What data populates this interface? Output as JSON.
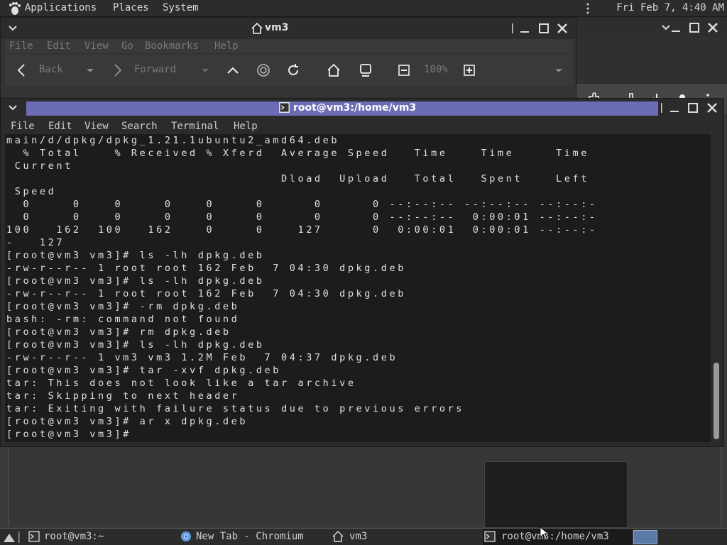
{
  "top_panel": {
    "menus": [
      "Applications",
      "Places",
      "System"
    ],
    "clock": "Fri Feb  7,  4:40 AM"
  },
  "file_manager": {
    "title": "vm3",
    "menus": [
      "File",
      "Edit",
      "View",
      "Go",
      "Bookmarks",
      "Help"
    ],
    "toolbar": {
      "back": "Back",
      "forward": "Forward",
      "zoom": "100%"
    }
  },
  "terminal": {
    "title": "root@vm3:/home/vm3",
    "menus": [
      "File",
      "Edit",
      "View",
      "Search",
      "Terminal",
      "Help"
    ],
    "lines": [
      "main/d/dpkg/dpkg_1.21.1ubuntu2_amd64.deb",
      "  % Total    % Received % Xferd  Average Speed   Time    Time     Time",
      " Current",
      "                                 Dload  Upload   Total   Spent    Left",
      " Speed",
      "  0     0    0     0    0     0      0      0 --:--:-- --:--:-- --:--:-",
      "  0     0    0     0    0     0      0      0 --:--:--  0:00:01 --:--:-",
      "100   162  100   162    0     0    127      0  0:00:01  0:00:01 --:--:-",
      "-   127",
      "[root@vm3 vm3]# ls -lh dpkg.deb",
      "-rw-r--r-- 1 root root 162 Feb  7 04:30 dpkg.deb",
      "[root@vm3 vm3]# ls -lh dpkg.deb",
      "-rw-r--r-- 1 root root 162 Feb  7 04:30 dpkg.deb",
      "[root@vm3 vm3]# -rm dpkg.deb",
      "bash: -rm: command not found",
      "[root@vm3 vm3]# rm dpkg.deb",
      "[root@vm3 vm3]# ls -lh dpkg.deb",
      "-rw-r--r-- 1 vm3 vm3 1.2M Feb  7 04:37 dpkg.deb",
      "[root@vm3 vm3]# tar -xvf dpkg.deb",
      "tar: This does not look like a tar archive",
      "tar: Skipping to next header",
      "tar: Exiting with failure status due to previous errors",
      "[root@vm3 vm3]# ar x dpkg.deb",
      "[root@vm3 vm3]# "
    ]
  },
  "taskbar": {
    "tasks": [
      {
        "label": "root@vm3:~",
        "icon": "terminal-icon"
      },
      {
        "label": "New Tab - Chromium",
        "icon": "chromium-icon"
      },
      {
        "label": "vm3",
        "icon": "home-folder-icon"
      },
      {
        "label": "root@vm3:/home/vm3",
        "icon": "terminal-icon"
      }
    ]
  },
  "colors": {
    "terminal_title_bar": "#6c6cb4",
    "terminal_bg": "#1c1c1c",
    "panel_bg": "#2c2c2c"
  }
}
